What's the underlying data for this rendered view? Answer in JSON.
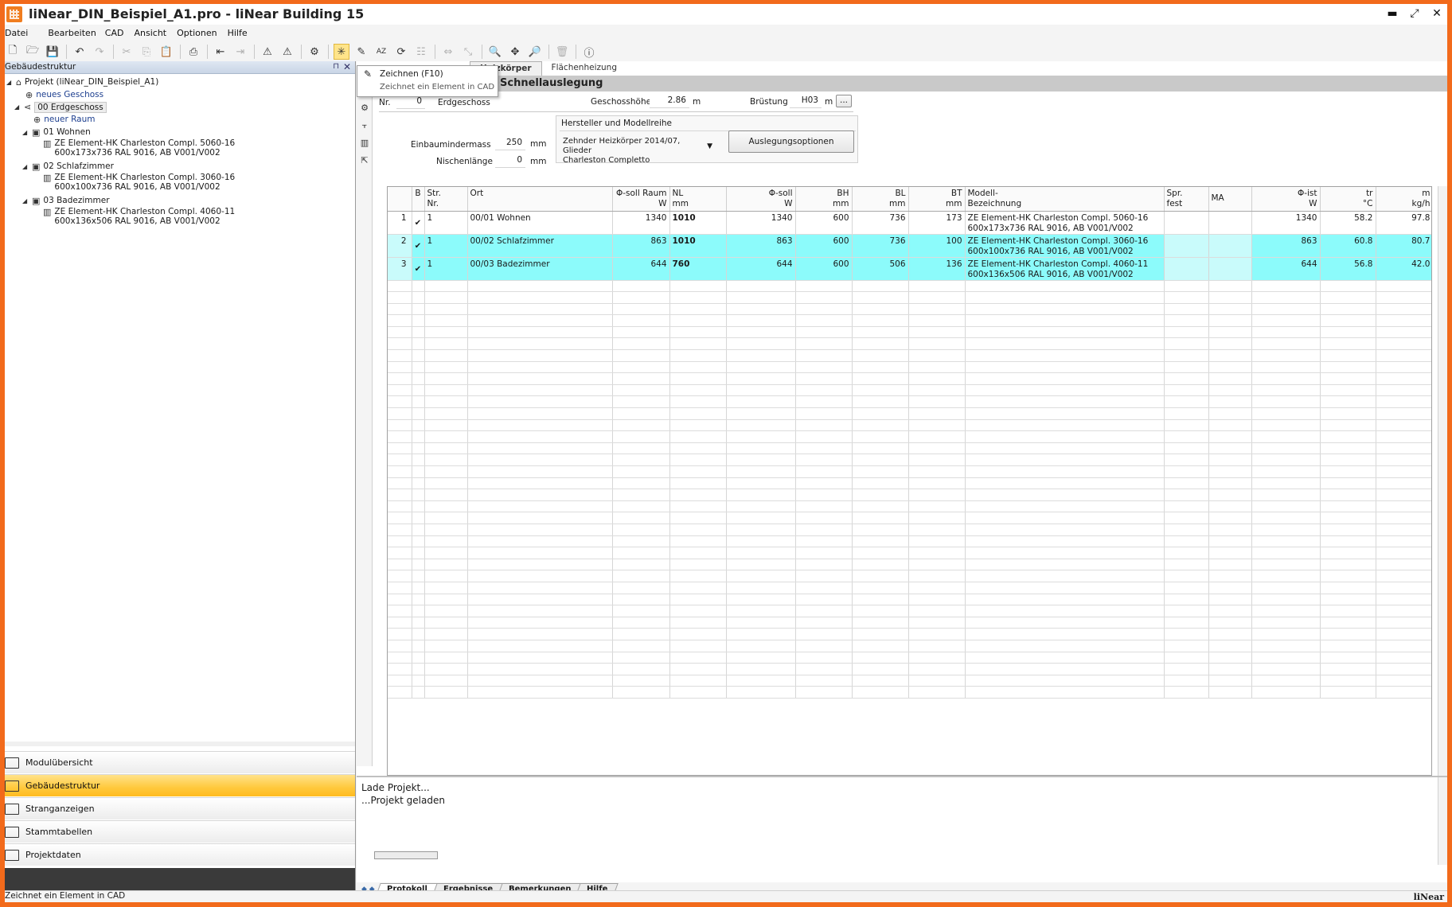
{
  "window": {
    "title": "liNear_DIN_Beispiel_A1.pro - liNear Building 15",
    "minimize": "▬",
    "restore": "⤢",
    "close": "✕"
  },
  "menu": [
    "Datei",
    "Bearbeiten",
    "CAD",
    "Ansicht",
    "Optionen",
    "Hilfe"
  ],
  "toolbar_icons": [
    "new-file-icon",
    "open-folder-icon",
    "save-icon",
    "undo-icon",
    "redo-icon",
    "cut-icon",
    "copy-icon",
    "paste-icon",
    "print-icon",
    "import-icon",
    "export-icon",
    "warning-icon",
    "warning-alt-icon",
    "settings-icon",
    "draw-element-icon",
    "edit-icon",
    "sort-az-icon",
    "refresh-icon",
    "hierarchy-icon",
    "fit-icon",
    "fit-alt-icon",
    "zoom-out-icon",
    "zoom-all-icon",
    "zoom-in-icon",
    "delete-icon",
    "info-icon"
  ],
  "left_panel": {
    "title": "Gebäudestruktur",
    "pin": "⊓",
    "close": "✕",
    "tree": {
      "project": "Projekt (liNear_DIN_Beispiel_A1)",
      "new_floor": "neues Geschoss",
      "floor": "00 Erdgeschoss",
      "new_room": "neuer Raum",
      "rooms": [
        {
          "name": "01 Wohnen",
          "line1": "ZE Element-HK Charleston Compl. 5060-16",
          "line2": "600x173x736 RAL 9016, AB V001/V002"
        },
        {
          "name": "02 Schlafzimmer",
          "line1": "ZE Element-HK Charleston Compl. 3060-16",
          "line2": "600x100x736 RAL 9016, AB V001/V002"
        },
        {
          "name": "03 Badezimmer",
          "line1": "ZE Element-HK Charleston Compl. 4060-11",
          "line2": "600x136x506 RAL 9016, AB V001/V002"
        }
      ]
    },
    "nav": [
      "Modulübersicht",
      "Gebäudestruktur",
      "Stranganzeigen",
      "Stammtabellen",
      "Projektdaten"
    ],
    "nav_active": 1
  },
  "tooltip": {
    "title": "Zeichnen (F10)",
    "desc": "Zeichnet ein Element in CAD"
  },
  "tabs": [
    "Heizkörper",
    "Flächenheizung"
  ],
  "header": "Schnellauslegung",
  "form": {
    "nr_label": "Nr.",
    "nr_value": "0",
    "floor_name": "Erdgeschoss",
    "height_label": "Geschosshöhe",
    "height_value": "2.86",
    "height_unit": "m",
    "parapet_label": "Brüstung",
    "parapet_value": "H03",
    "parapet_unit": "m",
    "more_btn": "...",
    "install_label": "Einbaumindermass",
    "install_value": "250",
    "install_unit": "mm",
    "niche_label": "Nischenlänge",
    "niche_value": "0",
    "niche_unit": "mm",
    "manufacturer_label": "Hersteller und Modellreihe",
    "manufacturer_value1": "Zehnder Heizkörper 2014/07, Glieder",
    "manufacturer_value2": "Charleston Completto",
    "options_btn": "Auslegungsoptionen"
  },
  "grid": {
    "columns": [
      {
        "l1": "",
        "l2": ""
      },
      {
        "l1": "B",
        "l2": ""
      },
      {
        "l1": "Str.",
        "l2": "Nr."
      },
      {
        "l1": "Ort",
        "l2": ""
      },
      {
        "l1": "Φ-soll Raum",
        "l2": "W"
      },
      {
        "l1": "NL",
        "l2": "mm"
      },
      {
        "l1": "Φ-soll",
        "l2": "W"
      },
      {
        "l1": "BH",
        "l2": "mm"
      },
      {
        "l1": "BL",
        "l2": "mm"
      },
      {
        "l1": "BT",
        "l2": "mm"
      },
      {
        "l1": "Modell-",
        "l2": "Bezeichnung"
      },
      {
        "l1": "Spr.",
        "l2": "fest"
      },
      {
        "l1": "MA",
        "l2": ""
      },
      {
        "l1": "Φ-ist",
        "l2": "W"
      },
      {
        "l1": "tr",
        "l2": "°C"
      },
      {
        "l1": "m",
        "l2": "kg/h"
      }
    ],
    "rows": [
      {
        "idx": "1",
        "check": "✔",
        "str": "1",
        "ort": "00/01 Wohnen",
        "phi_raum": "1340",
        "nl": "1010",
        "phi_soll": "1340",
        "bh": "600",
        "bl": "736",
        "bt": "173",
        "model1": "ZE Element-HK Charleston Compl. 5060-16",
        "model2": "600x173x736 RAL 9016, AB V001/V002",
        "spr": "",
        "ma": "",
        "phi_ist": "1340",
        "tr": "58.2",
        "m": "97.8"
      },
      {
        "idx": "2",
        "check": "✔",
        "str": "1",
        "ort": "00/02 Schlafzimmer",
        "phi_raum": "863",
        "nl": "1010",
        "phi_soll": "863",
        "bh": "600",
        "bl": "736",
        "bt": "100",
        "model1": "ZE Element-HK Charleston Compl. 3060-16",
        "model2": "600x100x736 RAL 9016, AB V001/V002",
        "spr": "",
        "ma": "",
        "phi_ist": "863",
        "tr": "60.8",
        "m": "80.7"
      },
      {
        "idx": "3",
        "check": "✔",
        "str": "1",
        "ort": "00/03 Badezimmer",
        "phi_raum": "644",
        "nl": "760",
        "phi_soll": "644",
        "bh": "600",
        "bl": "506",
        "bt": "136",
        "model1": "ZE Element-HK Charleston Compl. 4060-11",
        "model2": "600x136x506 RAL 9016, AB V001/V002",
        "spr": "",
        "ma": "",
        "phi_ist": "644",
        "tr": "56.8",
        "m": "42.0"
      }
    ]
  },
  "log": {
    "line1": "Lade Projekt...",
    "line2": "...Projekt geladen"
  },
  "bottom_tabs": [
    "Protokoll",
    "Ergebnisse",
    "Bemerkungen",
    "Hilfe"
  ],
  "status": {
    "text": "Zeichnet ein Element in CAD",
    "brand": "liNear"
  }
}
